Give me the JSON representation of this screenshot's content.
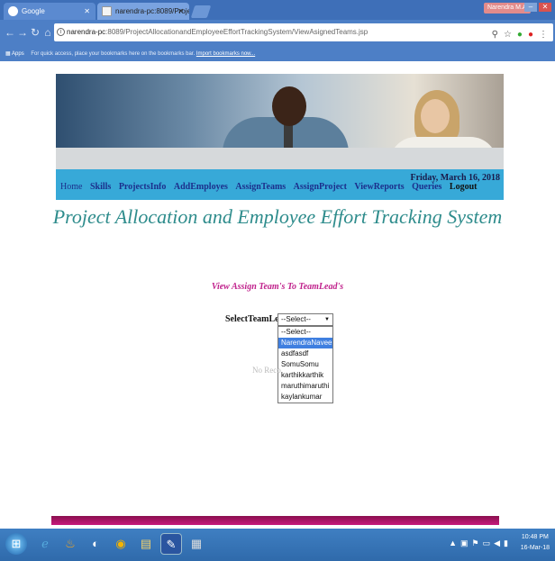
{
  "browser": {
    "tabs": [
      {
        "label": "Google"
      },
      {
        "label": "narendra-pc:8089/Projec"
      }
    ],
    "user_chip": "Narendra M.A",
    "address": {
      "host": "narendra-pc",
      "path": ":8089/ProjectAllocationandEmployeeEffortTrackingSystem/ViewAsignedTeams.jsp"
    },
    "bookmarks": {
      "apps_label": "Apps",
      "hint": "For quick access, place your bookmarks here on the bookmarks bar.",
      "link": "Import bookmarks now..."
    }
  },
  "nav": {
    "items": [
      "Home",
      "Skills",
      "ProjectsInfo",
      "AddEmployes",
      "AssignTeams",
      "AssignProject",
      "ViewReports",
      "Queries",
      "Logout"
    ],
    "date": "Friday, March 16, 2018"
  },
  "page": {
    "title": "Project Allocation and Employee Effort Tracking System",
    "subtitle": "View Assign Team's To TeamLead's",
    "select_label": "SelectTeamLead",
    "select_value": "--Select--",
    "options": [
      "--Select--",
      "NarendraNaveen",
      "asdfasdf",
      "SomuSomu",
      "karthikkarthik",
      "maruthimaruthi",
      "kaylankumar"
    ],
    "highlighted_option": 1,
    "no_records": "No Reco"
  },
  "taskbar": {
    "clock_time": "10:48 PM",
    "clock_date": "16-Mar-18"
  },
  "colors": {
    "nav_bg": "#37a9d8",
    "title": "#2e8c8c",
    "subtitle": "#c0228c",
    "highlight": "#3f7fe0"
  }
}
